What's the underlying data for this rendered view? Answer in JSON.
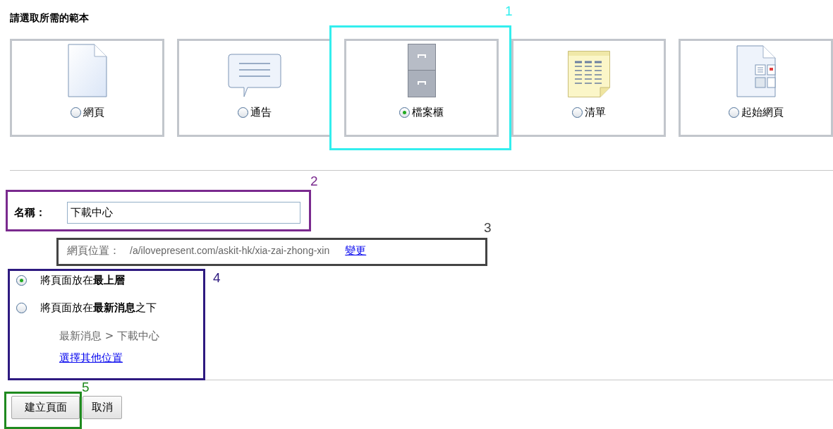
{
  "heading": "請選取所需的範本",
  "templates": [
    {
      "kind": "page",
      "label": "網頁",
      "selected": false
    },
    {
      "kind": "announcement",
      "label": "通告",
      "selected": false
    },
    {
      "kind": "cabinet",
      "label": "檔案櫃",
      "selected": true
    },
    {
      "kind": "list",
      "label": "清單",
      "selected": false
    },
    {
      "kind": "start",
      "label": "起始網頁",
      "selected": false
    }
  ],
  "name_field": {
    "label": "名稱：",
    "value": "下載中心"
  },
  "location": {
    "label": "網頁位置：",
    "path": "/a/ilovepresent.com/askit-hk/xia-zai-zhong-xin",
    "link": "變更"
  },
  "placement": {
    "options": [
      {
        "label": "將頁面放在**最上層**",
        "selected": true
      },
      {
        "label": "將頁面放在**最新消息**之下",
        "selected": false
      }
    ],
    "breadcrumb": "最新消息 > 下載中心",
    "link": "選擇其他位置"
  },
  "buttons": [
    {
      "label": "建立頁面"
    },
    {
      "label": "取消"
    }
  ],
  "annotations": [
    {
      "number": "1",
      "color": "#33eeee"
    },
    {
      "number": "2",
      "color": "#7a2a8e"
    },
    {
      "number": "3",
      "color": "#444444"
    },
    {
      "number": "4",
      "color": "#2e1a80"
    },
    {
      "number": "5",
      "color": "#1f8a1f"
    }
  ]
}
